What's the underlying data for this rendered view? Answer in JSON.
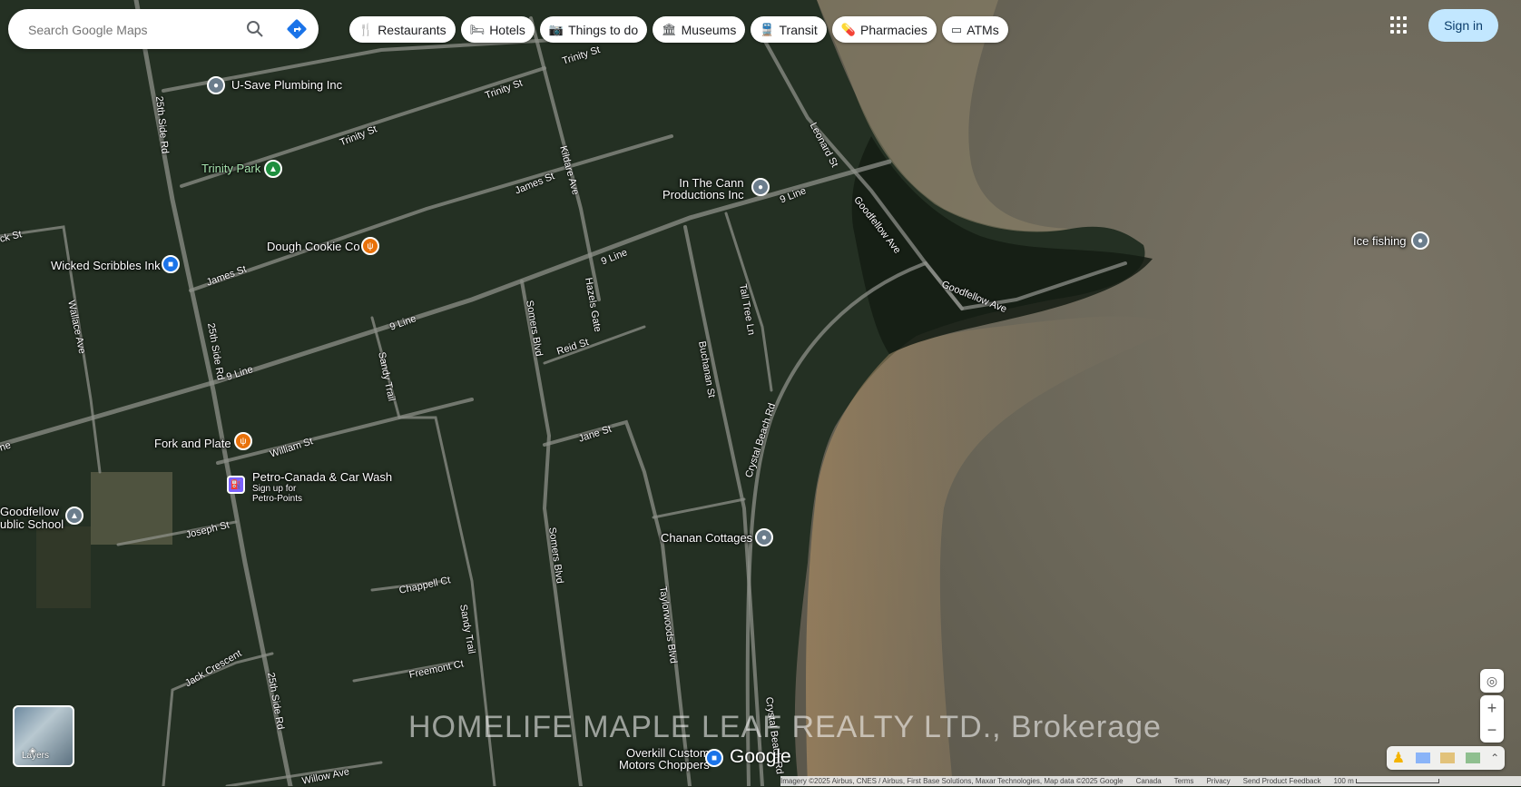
{
  "search": {
    "placeholder": "Search Google Maps"
  },
  "chips": [
    {
      "icon": "restaurant-icon",
      "glyph": "🍴",
      "label": "Restaurants"
    },
    {
      "icon": "hotel-icon",
      "glyph": "🛏",
      "label": "Hotels"
    },
    {
      "icon": "camera-icon",
      "glyph": "📷",
      "label": "Things to do"
    },
    {
      "icon": "museum-icon",
      "glyph": "🏛",
      "label": "Museums"
    },
    {
      "icon": "transit-icon",
      "glyph": "🚆",
      "label": "Transit"
    },
    {
      "icon": "pharmacy-icon",
      "glyph": "💊",
      "label": "Pharmacies"
    },
    {
      "icon": "atm-icon",
      "glyph": "▭",
      "label": "ATMs"
    }
  ],
  "account": {
    "signin_label": "Sign in"
  },
  "places": {
    "u_save": "U-Save Plumbing Inc",
    "trinity_park": "Trinity Park",
    "in_the_cann": "In The Cann\nProductions Inc",
    "ice_fishing": "Ice fishing",
    "dough_cookie": "Dough Cookie Co",
    "wicked_scribbles": "Wicked Scribbles Ink",
    "fork_plate": "Fork and Plate",
    "petro_canada": "Petro-Canada & Car Wash",
    "petro_sub": "Sign up for\nPetro-Points",
    "goodfellow_school": "Goodfellow\nublic School",
    "chanan": "Chanan Cottages",
    "overkill": "Overkill Custom\nMotors Choppers"
  },
  "streets": {
    "s25_top": "25th Side Rd",
    "s25_mid": "25th Side Rd",
    "s25_bottom": "25th Side Rd",
    "trinity1": "Trinity St",
    "trinity2": "Trinity St",
    "trinity3": "Trinity St",
    "kildare": "Kildare Ave",
    "leonard": "Leonard St",
    "james1": "James St",
    "james2": "James St",
    "nine_line1": "9 Line",
    "nine_line2": "9 Line",
    "nine_line3": "9 Line",
    "nine_line4": "9 Line",
    "nine_line5": "ne",
    "goodfellow1": "Goodfellow Ave",
    "goodfellow2": "Goodfellow Ave",
    "wallace": "Wallace Ave",
    "ck_st": "ck St",
    "hazels": "Hazels Gate",
    "somers1": "Somers Blvd",
    "somers2": "Somers Blvd",
    "reid": "Reid St",
    "buchanan": "Buchanan St",
    "tall_tree": "Tall Tree Ln",
    "sandy1": "Sandy Trail",
    "sandy2": "Sandy Trail",
    "crystal1": "Crystal Beach Rd",
    "crystal2": "Crystal Beach Rd",
    "william": "William St",
    "jane": "Jane St",
    "joseph": "Joseph St",
    "chappell": "Chappell Ct",
    "taylorwoods": "Taylorwoods Blvd",
    "freemont": "Freemont Ct",
    "jack": "Jack Crescent",
    "willow": "Willow Ave"
  },
  "overlay": {
    "watermark": "HOMELIFE MAPLE LEAF REALTY LTD., Brokerage",
    "google": "Google",
    "layers_label": "Layers"
  },
  "attribution": {
    "imagery": "Imagery ©2025 Airbus, CNES / Airbus, First Base Solutions, Maxar Technologies, Map data ©2025 Google",
    "country": "Canada",
    "terms": "Terms",
    "privacy": "Privacy",
    "feedback": "Send Product Feedback",
    "scale": "100 m"
  }
}
